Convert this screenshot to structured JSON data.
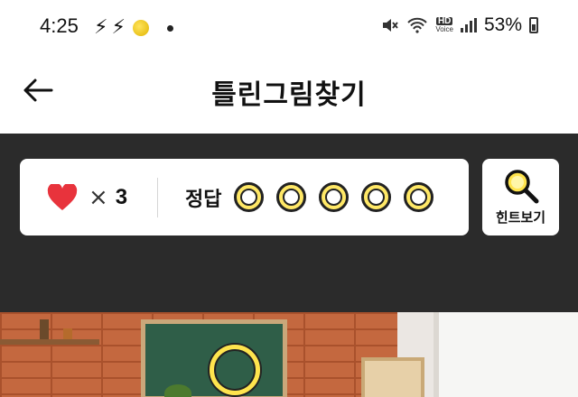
{
  "status_bar": {
    "time": "4:25",
    "battery_percent": "53%",
    "hd_label": "HD",
    "voice_label": "Voice",
    "icons": [
      "bolt-icon",
      "bolt-icon",
      "coin-icon",
      "dot",
      "mute-icon",
      "wifi-icon",
      "hd-voice-icon",
      "signal-icon",
      "battery-icon"
    ]
  },
  "header": {
    "title": "틀린그림찾기",
    "back_icon": "back-arrow-icon"
  },
  "game": {
    "lives_multiplier": "×",
    "lives_count": "3",
    "answer_label": "정답",
    "answer_total": 5,
    "answers_found": 0,
    "hint_label": "힌트보기",
    "hint_icon": "magnifier-icon",
    "colors": {
      "heart": "#e8333c",
      "circle_fill": "#ffe866",
      "dark_bg": "#2b2b2b"
    }
  },
  "picture": {
    "description_icon": "scene-image"
  }
}
